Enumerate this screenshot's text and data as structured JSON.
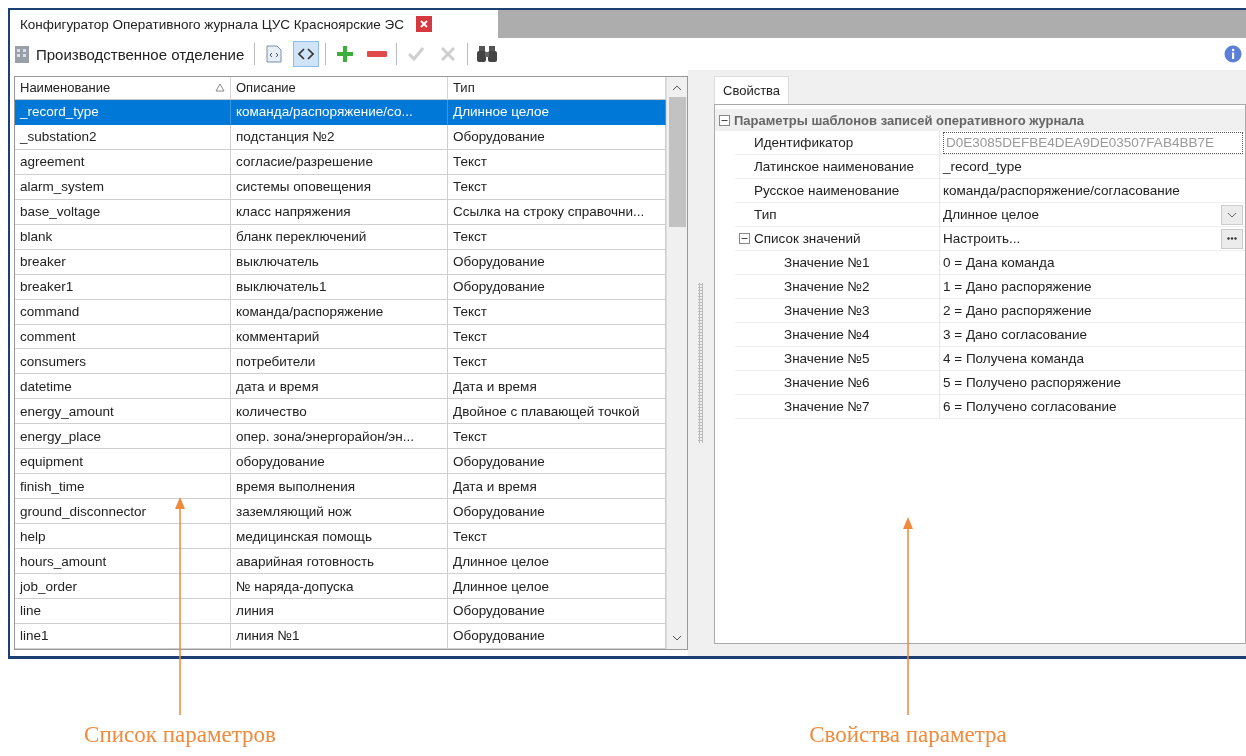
{
  "window": {
    "title": "Конфигуратор Оперативного журнала ЦУС Красноярские ЭС"
  },
  "toolbar": {
    "label": "Производственное отделение",
    "buttons": [
      {
        "kind": "document",
        "selected": false,
        "disabled": false
      },
      {
        "kind": "code",
        "selected": true,
        "disabled": false
      },
      {
        "kind": "add",
        "selected": false,
        "disabled": false
      },
      {
        "kind": "remove",
        "selected": false,
        "disabled": false
      },
      {
        "kind": "apply",
        "selected": false,
        "disabled": true
      },
      {
        "kind": "cancel",
        "selected": false,
        "disabled": true
      },
      {
        "kind": "find",
        "selected": false,
        "disabled": false
      }
    ]
  },
  "table": {
    "columns": [
      {
        "label": "Наименование",
        "sorted": true
      },
      {
        "label": "Описание",
        "sorted": false
      },
      {
        "label": "Тип",
        "sorted": false
      }
    ],
    "rows": [
      {
        "cells": [
          "_record_type",
          "команда/распоряжение/со...",
          "Длинное целое"
        ],
        "selected": true
      },
      {
        "cells": [
          "_substation2",
          "подстанция №2",
          "Оборудование"
        ],
        "selected": false
      },
      {
        "cells": [
          "agreement",
          "согласие/разрешение",
          "Текст"
        ],
        "selected": false
      },
      {
        "cells": [
          "alarm_system",
          "системы оповещения",
          "Текст"
        ],
        "selected": false
      },
      {
        "cells": [
          "base_voltage",
          "класс напряжения",
          "Ссылка на строку справочни..."
        ],
        "selected": false
      },
      {
        "cells": [
          "blank",
          "бланк переключений",
          "Текст"
        ],
        "selected": false
      },
      {
        "cells": [
          "breaker",
          "выключатель",
          "Оборудование"
        ],
        "selected": false
      },
      {
        "cells": [
          "breaker1",
          "выключатель1",
          "Оборудование"
        ],
        "selected": false
      },
      {
        "cells": [
          "command",
          "команда/распоряжение",
          "Текст"
        ],
        "selected": false
      },
      {
        "cells": [
          "comment",
          "комментарий",
          "Текст"
        ],
        "selected": false
      },
      {
        "cells": [
          "consumers",
          "потребители",
          "Текст"
        ],
        "selected": false
      },
      {
        "cells": [
          "datetime",
          "дата и время",
          "Дата и время"
        ],
        "selected": false
      },
      {
        "cells": [
          "energy_amount",
          "количество",
          "Двойное с плавающей точкой"
        ],
        "selected": false
      },
      {
        "cells": [
          "energy_place",
          "опер. зона/энергорайон/эн...",
          "Текст"
        ],
        "selected": false
      },
      {
        "cells": [
          "equipment",
          "оборудование",
          "Оборудование"
        ],
        "selected": false
      },
      {
        "cells": [
          "finish_time",
          "время выполнения",
          "Дата и время"
        ],
        "selected": false
      },
      {
        "cells": [
          "ground_disconnector",
          "заземляющий нож",
          "Оборудование"
        ],
        "selected": false
      },
      {
        "cells": [
          "help",
          "медицинская помощь",
          "Текст"
        ],
        "selected": false
      },
      {
        "cells": [
          "hours_amount",
          "аварийная готовность",
          "Длинное целое"
        ],
        "selected": false
      },
      {
        "cells": [
          "job_order",
          "№ наряда-допуска",
          "Длинное целое"
        ],
        "selected": false
      },
      {
        "cells": [
          "line",
          "линия",
          "Оборудование"
        ],
        "selected": false
      },
      {
        "cells": [
          "line1",
          "линия №1",
          "Оборудование"
        ],
        "selected": false
      }
    ]
  },
  "properties": {
    "tab": {
      "label": "Свойства",
      "selected": true
    },
    "category": {
      "label": "Параметры шаблонов записей оперативного журнала",
      "expanded": true,
      "items": [
        {
          "label": "Идентификатор",
          "value": "D0E3085DEFBE4DEA9DE03507FAB4BB7E",
          "kind": "readonly"
        },
        {
          "label": "Латинское наименование",
          "value": "_record_type",
          "kind": "text"
        },
        {
          "label": "Русское наименование",
          "value": "команда/распоряжение/согласование",
          "kind": "text"
        },
        {
          "label": "Тип",
          "value": "Длинное целое",
          "kind": "dropdown"
        },
        {
          "label": "Список значений",
          "value": "Настроить...",
          "kind": "ellipsis",
          "expanded": true,
          "children": [
            {
              "label": "Значение №1",
              "value": "0 = Дана команда",
              "kind": "text"
            },
            {
              "label": "Значение №2",
              "value": "1 = Дано распоряжение",
              "kind": "text"
            },
            {
              "label": "Значение №3",
              "value": "2 = Дано распоряжение",
              "kind": "text"
            },
            {
              "label": "Значение №4",
              "value": "3 = Дано согласование",
              "kind": "text"
            },
            {
              "label": "Значение №5",
              "value": "4 = Получена команда",
              "kind": "text"
            },
            {
              "label": "Значение №6",
              "value": "5 = Получено распоряжение",
              "kind": "text"
            },
            {
              "label": "Значение №7",
              "value": "6 = Получено согласование",
              "kind": "text"
            }
          ]
        }
      ]
    }
  },
  "annotations": [
    {
      "label": "Список параметров"
    },
    {
      "label": "Свойства параметра"
    }
  ]
}
